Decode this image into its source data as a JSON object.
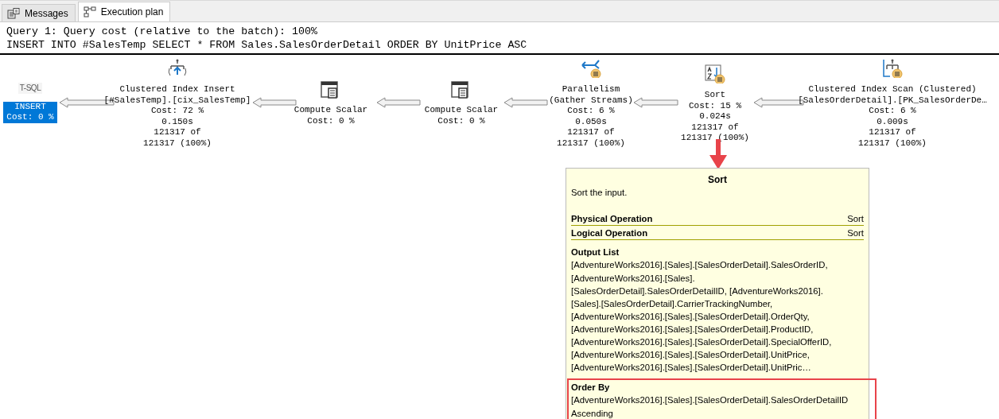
{
  "tabs": [
    {
      "label": "Messages",
      "selected": false
    },
    {
      "label": "Execution plan",
      "selected": true
    }
  ],
  "query": {
    "header": "Query 1: Query cost (relative to the batch): 100%",
    "statement": "INSERT INTO #SalesTemp SELECT * FROM Sales.SalesOrderDetail ORDER BY UnitPrice ASC"
  },
  "plan_nodes": [
    {
      "kind": "root",
      "icon_text": "T-SQL",
      "title_lines": [
        "INSERT"
      ],
      "cost": "Cost: 0 %",
      "selected": true
    },
    {
      "kind": "insert",
      "title_lines": [
        "Clustered Index Insert",
        "[#SalesTemp].[cix_SalesTemp]"
      ],
      "cost": "Cost: 72 %",
      "time": "0.150s",
      "rows_lines": [
        "121317 of",
        "121317 (100%)"
      ],
      "selected": false,
      "parallel": false
    },
    {
      "kind": "compute",
      "title_lines": [
        "Compute Scalar"
      ],
      "cost": "Cost: 0 %",
      "selected": false,
      "parallel": false
    },
    {
      "kind": "compute",
      "title_lines": [
        "Compute Scalar"
      ],
      "cost": "Cost: 0 %",
      "selected": false,
      "parallel": false
    },
    {
      "kind": "parallelism",
      "title_lines": [
        "Parallelism",
        "(Gather Streams)"
      ],
      "cost": "Cost: 6 %",
      "time": "0.050s",
      "rows_lines": [
        "121317 of",
        "121317 (100%)"
      ],
      "selected": false,
      "parallel": true
    },
    {
      "kind": "sort",
      "title_lines": [
        "Sort"
      ],
      "cost": "Cost: 15 %",
      "time": "0.024s",
      "rows_lines": [
        "121317 of",
        "121317 (100%)"
      ],
      "selected": false,
      "parallel": true
    },
    {
      "kind": "scan",
      "title_lines": [
        "Clustered Index Scan (Clustered)",
        "[SalesOrderDetail].[PK_SalesOrderDe…"
      ],
      "cost": "Cost: 6 %",
      "time": "0.009s",
      "rows_lines": [
        "121317 of",
        "121317 (100%)"
      ],
      "selected": false,
      "parallel": true
    }
  ],
  "tooltip": {
    "title": "Sort",
    "description": "Sort the input.",
    "properties": [
      {
        "name": "Physical Operation",
        "value": "Sort"
      },
      {
        "name": "Logical Operation",
        "value": "Sort"
      }
    ],
    "sections": [
      {
        "heading": "Output List",
        "highlighted": false,
        "lines": [
          "[AdventureWorks2016].[Sales].[SalesOrderDetail].SalesOrderID,",
          "[AdventureWorks2016].[Sales].",
          "[SalesOrderDetail].SalesOrderDetailID, [AdventureWorks2016].",
          "[Sales].[SalesOrderDetail].CarrierTrackingNumber,",
          "[AdventureWorks2016].[Sales].[SalesOrderDetail].OrderQty,",
          "[AdventureWorks2016].[Sales].[SalesOrderDetail].ProductID,",
          "[AdventureWorks2016].[Sales].[SalesOrderDetail].SpecialOfferID,",
          "[AdventureWorks2016].[Sales].[SalesOrderDetail].UnitPrice,",
          "[AdventureWorks2016].[Sales].[SalesOrderDetail].UnitPric…"
        ]
      },
      {
        "heading": "Order By",
        "highlighted": true,
        "lines": [
          "[AdventureWorks2016].[Sales].[SalesOrderDetail].SalesOrderDetailID",
          "Ascending"
        ]
      }
    ]
  }
}
